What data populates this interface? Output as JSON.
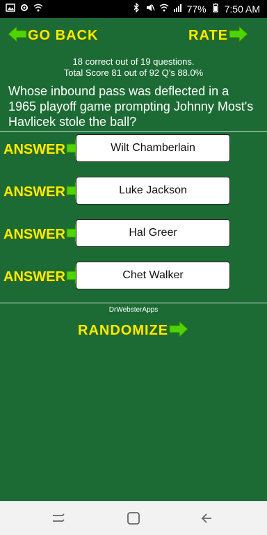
{
  "status": {
    "battery": "77%",
    "time": "7:50 AM"
  },
  "nav": {
    "go_back": "GO BACK",
    "rate": "RATE"
  },
  "score": {
    "line1": "18 correct out of 19 questions.",
    "line2": "Total Score 81 out of 92 Q's  88.0%"
  },
  "question": {
    "text": "Whose inbound pass was deflected in a 1965 playoff game prompting Johnny Most's Havlicek stole the ball?"
  },
  "answers": [
    {
      "tag": "ANSWER",
      "label": "Wilt Chamberlain"
    },
    {
      "tag": "ANSWER",
      "label": "Luke Jackson"
    },
    {
      "tag": "ANSWER",
      "label": "Hal Greer"
    },
    {
      "tag": "ANSWER",
      "label": "Chet Walker"
    }
  ],
  "footer": {
    "credit": "DrWebsterApps",
    "randomize": "RANDOMIZE"
  },
  "colors": {
    "background": "#1c6b34",
    "accent_yellow": "#f1f000",
    "arrow_green": "#4fd400"
  },
  "icons": {
    "arrow": "green-right-arrow-icon",
    "back_arrow": "green-left-arrow-icon"
  }
}
